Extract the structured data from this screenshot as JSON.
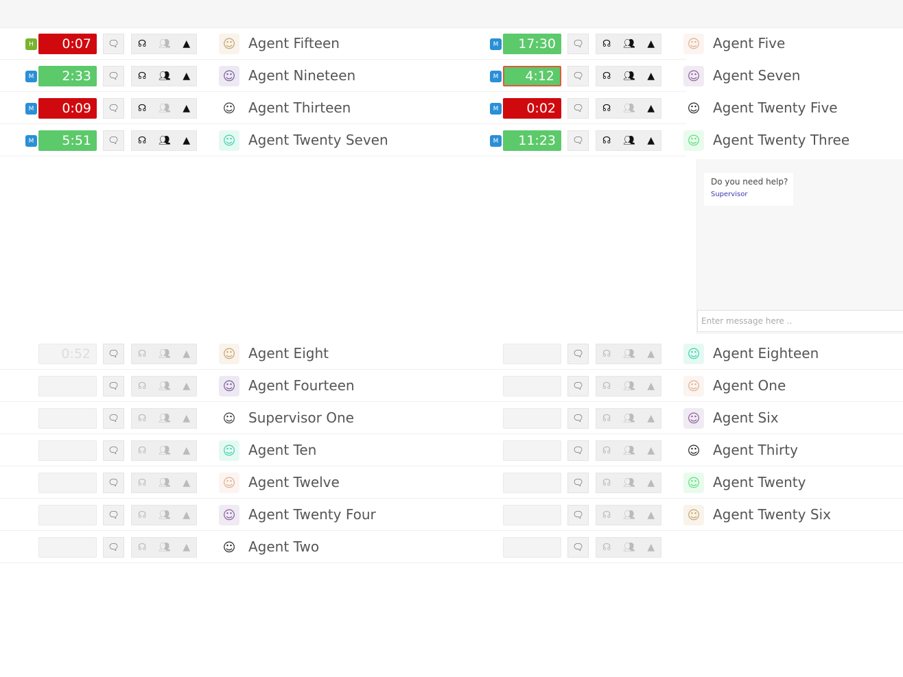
{
  "colors": {
    "red": "#d0090e",
    "green": "#5cc96a",
    "badge_blue": "#2a8fd6",
    "badge_green": "#7ab32e",
    "link": "#3a3ab0"
  },
  "icons": {
    "chat": "chat-bubbles-icon",
    "listen": "headset-icon",
    "conference": "group-icon",
    "user": "user-icon"
  },
  "active_rows": [
    {
      "left": {
        "badge": "H",
        "badge_color": "green",
        "timer": "0:07",
        "timer_state": "red",
        "conference_on": false,
        "agent": "Agent Fifteen"
      },
      "right": {
        "badge": "M",
        "badge_color": "blue",
        "timer": "17:30",
        "timer_state": "green",
        "conference_on": true,
        "agent": "Agent Five"
      }
    },
    {
      "left": {
        "badge": "M",
        "badge_color": "blue",
        "timer": "2:33",
        "timer_state": "green",
        "conference_on": true,
        "agent": "Agent Nineteen"
      },
      "right": {
        "badge": "M",
        "badge_color": "blue",
        "timer": "4:12",
        "timer_state": "green",
        "conference_on": true,
        "agent": "Agent Seven"
      }
    },
    {
      "left": {
        "badge": "M",
        "badge_color": "blue",
        "timer": "0:09",
        "timer_state": "red",
        "conference_on": false,
        "agent": "Agent Thirteen"
      },
      "right": {
        "badge": "M",
        "badge_color": "blue",
        "timer": "0:02",
        "timer_state": "red",
        "conference_on": false,
        "agent": "Agent Twenty Five"
      }
    },
    {
      "left": {
        "badge": "M",
        "badge_color": "blue",
        "timer": "5:51",
        "timer_state": "green",
        "conference_on": true,
        "agent": "Agent Twenty Seven"
      },
      "right": {
        "badge": "M",
        "badge_color": "blue",
        "timer": "11:23",
        "timer_state": "green",
        "conference_on": true,
        "agent": "Agent Twenty Three"
      }
    }
  ],
  "chat": {
    "message": "Do you need help?",
    "sender": "Supervisor",
    "input_placeholder": "Enter message here .."
  },
  "idle_rows": [
    {
      "left": {
        "timer": "0:52",
        "agent": "Agent Eight"
      },
      "right": {
        "agent": "Agent Eighteen"
      }
    },
    {
      "left": {
        "timer": "",
        "agent": "Agent Fourteen"
      },
      "right": {
        "agent": "Agent One"
      }
    },
    {
      "left": {
        "timer": "",
        "agent": "Supervisor One"
      },
      "right": {
        "agent": "Agent Six"
      }
    },
    {
      "left": {
        "timer": "",
        "agent": "Agent Ten"
      },
      "right": {
        "agent": "Agent Thirty"
      }
    },
    {
      "left": {
        "timer": "",
        "agent": "Agent Twelve"
      },
      "right": {
        "agent": "Agent Twenty"
      }
    },
    {
      "left": {
        "timer": "",
        "agent": "Agent Twenty Four"
      },
      "right": {
        "agent": "Agent Twenty Six"
      }
    },
    {
      "left": {
        "timer": "",
        "agent": "Agent Two"
      },
      "right": {
        "agent": ""
      }
    }
  ]
}
